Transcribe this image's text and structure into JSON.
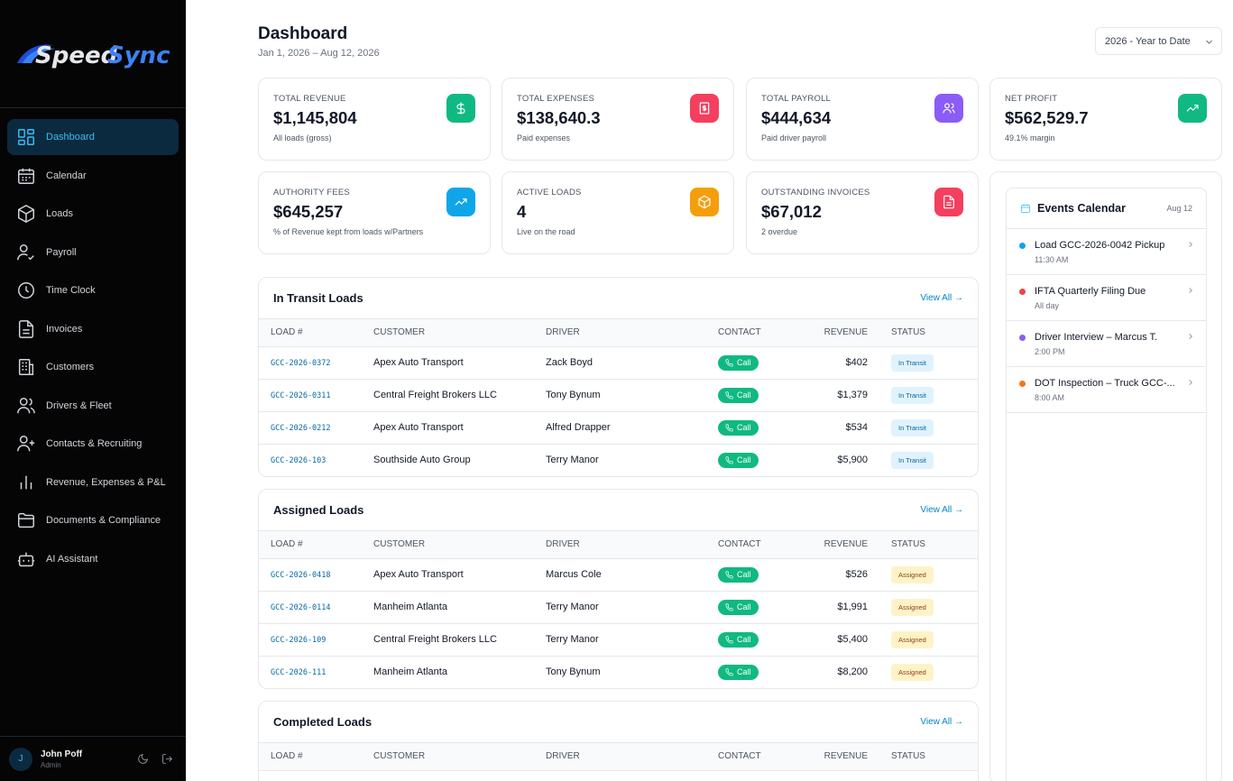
{
  "app": {
    "logo_text_a": "Speed",
    "logo_text_b": "Sync"
  },
  "sidebar": {
    "items": [
      {
        "label": "Dashboard",
        "icon": "dashboard-icon"
      },
      {
        "label": "Calendar",
        "icon": "calendar-icon"
      },
      {
        "label": "Loads",
        "icon": "box-icon"
      },
      {
        "label": "Payroll",
        "icon": "user-check-icon"
      },
      {
        "label": "Time Clock",
        "icon": "clock-icon"
      },
      {
        "label": "Invoices",
        "icon": "file-icon"
      },
      {
        "label": "Customers",
        "icon": "building-icon"
      },
      {
        "label": "Drivers & Fleet",
        "icon": "users-icon"
      },
      {
        "label": "Contacts & Recruiting",
        "icon": "user-plus-icon"
      },
      {
        "label": "Revenue, Expenses & P&L",
        "icon": "bar-chart-icon"
      },
      {
        "label": "Documents & Compliance",
        "icon": "folder-icon"
      },
      {
        "label": "AI Assistant",
        "icon": "bot-icon"
      }
    ],
    "user": {
      "initial": "J",
      "name": "John Poff",
      "role": "Admin"
    }
  },
  "header": {
    "title": "Dashboard",
    "subtitle": "Jan 1, 2026 – Aug 12, 2026",
    "range": "2026 - Year to Date"
  },
  "stats": [
    {
      "label": "TOTAL REVENUE",
      "value": "$1,145,804",
      "sub": "All loads (gross)",
      "color": "#10b981",
      "icon": "dollar-icon"
    },
    {
      "label": "TOTAL EXPENSES",
      "value": "$138,640.3",
      "sub": "Paid expenses",
      "color": "#f43f5e",
      "icon": "receipt-icon"
    },
    {
      "label": "TOTAL PAYROLL",
      "value": "$444,634",
      "sub": "Paid driver payroll",
      "color": "#8b5cf6",
      "icon": "users-icon"
    },
    {
      "label": "NET PROFIT",
      "value": "$562,529.7",
      "sub": "49.1% margin",
      "color": "#10b981",
      "icon": "trending-up-icon"
    },
    {
      "label": "AUTHORITY FEES",
      "value": "$645,257",
      "sub": "% of Revenue kept from loads w/Partners",
      "color": "#0ea5e9",
      "icon": "trending-up-icon"
    },
    {
      "label": "ACTIVE LOADS",
      "value": "4",
      "sub": "Live on the road",
      "color": "#f59e0b",
      "icon": "box-icon"
    },
    {
      "label": "OUTSTANDING INVOICES",
      "value": "$67,012",
      "sub": "2 overdue",
      "color": "#f43f5e",
      "icon": "file-icon"
    }
  ],
  "table_headers": {
    "load": "LOAD #",
    "customer": "CUSTOMER",
    "driver": "DRIVER",
    "contact": "CONTACT",
    "revenue": "REVENUE",
    "status": "STATUS"
  },
  "call_label": "Call",
  "view_all": "View All →",
  "in_transit": {
    "title": "In Transit Loads",
    "rows": [
      {
        "load": "GCC-2026-0372",
        "customer": "Apex Auto Transport",
        "driver": "Zack Boyd",
        "revenue": "$402",
        "status": "In Transit"
      },
      {
        "load": "GCC-2026-0311",
        "customer": "Central Freight Brokers LLC",
        "driver": "Tony Bynum",
        "revenue": "$1,379",
        "status": "In Transit"
      },
      {
        "load": "GCC-2026-0212",
        "customer": "Apex Auto Transport",
        "driver": "Alfred Drapper",
        "revenue": "$534",
        "status": "In Transit"
      },
      {
        "load": "GCC-2026-103",
        "customer": "Southside Auto Group",
        "driver": "Terry Manor",
        "revenue": "$5,900",
        "status": "In Transit"
      }
    ]
  },
  "assigned": {
    "title": "Assigned Loads",
    "rows": [
      {
        "load": "GCC-2026-0418",
        "customer": "Apex Auto Transport",
        "driver": "Marcus Cole",
        "revenue": "$526",
        "status": "Assigned"
      },
      {
        "load": "GCC-2026-0114",
        "customer": "Manheim Atlanta",
        "driver": "Terry Manor",
        "revenue": "$1,991",
        "status": "Assigned"
      },
      {
        "load": "GCC-2026-109",
        "customer": "Central Freight Brokers LLC",
        "driver": "Terry Manor",
        "revenue": "$5,400",
        "status": "Assigned"
      },
      {
        "load": "GCC-2026-111",
        "customer": "Manheim Atlanta",
        "driver": "Tony Bynum",
        "revenue": "$8,200",
        "status": "Assigned"
      }
    ]
  },
  "completed": {
    "title": "Completed Loads"
  },
  "events": {
    "title": "Events Calendar",
    "date": "Aug 12",
    "items": [
      {
        "title": "Load GCC-2026-0042 Pickup",
        "time": "11:30 AM",
        "color": "#0ea5e9"
      },
      {
        "title": "IFTA Quarterly Filing Due",
        "time": "All day",
        "color": "#ef4444"
      },
      {
        "title": "Driver Interview – Marcus T.",
        "time": "2:00 PM",
        "color": "#8b5cf6"
      },
      {
        "title": "DOT Inspection – Truck GCC-...",
        "time": "8:00 AM",
        "color": "#f97316"
      }
    ]
  }
}
